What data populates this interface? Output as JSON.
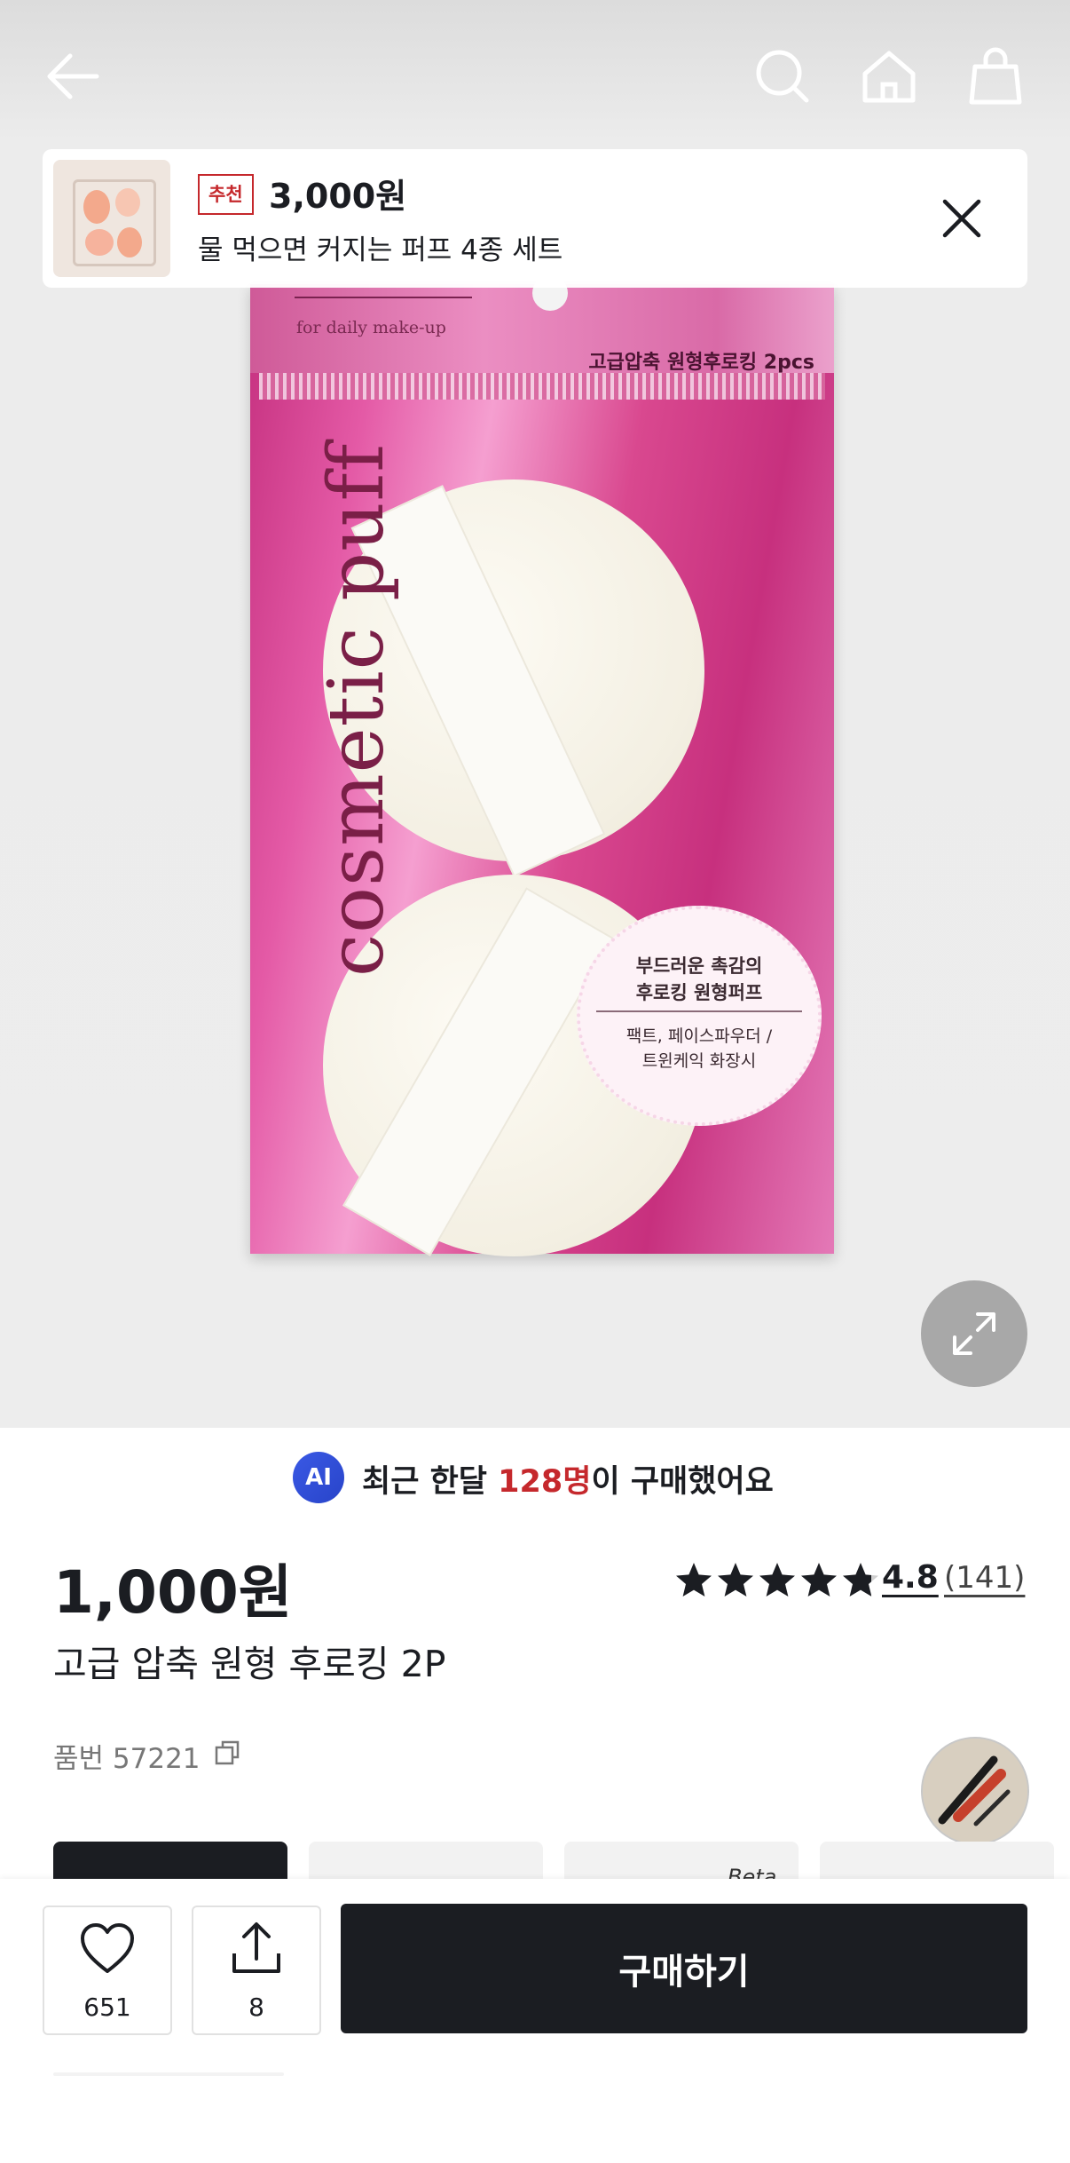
{
  "promo": {
    "badge": "추천",
    "price": "3,000원",
    "description": "물 먹으면 커지는 퍼프 4종 세트"
  },
  "product_image": {
    "package_tagline": "for daily make-up",
    "package_name": "고급압축 원형후로킹 2pcs",
    "package_brand": "cosmetic puff",
    "seal_line1": "부드러운 촉감의",
    "seal_line2": "후로킹 원형퍼프",
    "seal_line3": "팩트, 페이스파우더 /",
    "seal_line4": "트윈케익 화장시"
  },
  "buyers": {
    "ai_label": "AI",
    "prefix": "최근 한달 ",
    "count": "128명",
    "suffix": "이 구매했어요"
  },
  "product": {
    "price": "1,000원",
    "rating": "4.8",
    "rating_value": 4.8,
    "rating_count": "(141)",
    "name": "고급 압축 원형 후로킹 2P",
    "sku": "품번 57221"
  },
  "tabs_peek": {
    "beta_label": "Beta"
  },
  "bottom_bar": {
    "like_count": "651",
    "share_count": "8",
    "buy_label": "구매하기"
  },
  "colors": {
    "accent_red": "#c5282c",
    "dark": "#1b1d22",
    "ai_blue": "#3a59e5"
  }
}
